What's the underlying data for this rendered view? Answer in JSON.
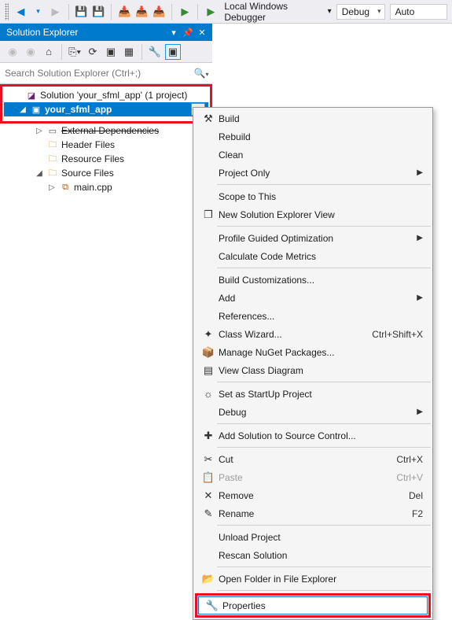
{
  "toolbar": {
    "debugger_label": "Local Windows Debugger",
    "config_value": "Debug",
    "platform_value": "Auto"
  },
  "panel": {
    "title": "Solution Explorer",
    "search_placeholder": "Search Solution Explorer (Ctrl+;)"
  },
  "tree": {
    "solution_label": "Solution 'your_sfml_app' (1 project)",
    "project_label": "your_sfml_app",
    "ext_deps": "External Dependencies",
    "header_files": "Header Files",
    "resource_files": "Resource Files",
    "source_files": "Source Files",
    "main_cpp": "main.cpp"
  },
  "ctx": [
    {
      "type": "item",
      "icon": "hammer",
      "label": "Build"
    },
    {
      "type": "item",
      "label": "Rebuild"
    },
    {
      "type": "item",
      "label": "Clean"
    },
    {
      "type": "item",
      "label": "Project Only",
      "submenu": true
    },
    {
      "type": "sep"
    },
    {
      "type": "item",
      "label": "Scope to This"
    },
    {
      "type": "item",
      "icon": "new-view",
      "label": "New Solution Explorer View"
    },
    {
      "type": "sep"
    },
    {
      "type": "item",
      "label": "Profile Guided Optimization",
      "submenu": true
    },
    {
      "type": "item",
      "label": "Calculate Code Metrics"
    },
    {
      "type": "sep"
    },
    {
      "type": "item",
      "label": "Build Customizations..."
    },
    {
      "type": "item",
      "label": "Add",
      "submenu": true
    },
    {
      "type": "item",
      "label": "References..."
    },
    {
      "type": "item",
      "icon": "wizard",
      "label": "Class Wizard...",
      "shortcut": "Ctrl+Shift+X"
    },
    {
      "type": "item",
      "icon": "nuget",
      "label": "Manage NuGet Packages..."
    },
    {
      "type": "item",
      "icon": "class-diagram",
      "label": "View Class Diagram"
    },
    {
      "type": "sep"
    },
    {
      "type": "item",
      "icon": "startup",
      "label": "Set as StartUp Project"
    },
    {
      "type": "item",
      "label": "Debug",
      "submenu": true
    },
    {
      "type": "sep"
    },
    {
      "type": "item",
      "icon": "source-control",
      "label": "Add Solution to Source Control..."
    },
    {
      "type": "sep"
    },
    {
      "type": "item",
      "icon": "cut",
      "label": "Cut",
      "shortcut": "Ctrl+X"
    },
    {
      "type": "item",
      "icon": "paste",
      "label": "Paste",
      "shortcut": "Ctrl+V",
      "disabled": true
    },
    {
      "type": "item",
      "icon": "remove",
      "label": "Remove",
      "shortcut": "Del"
    },
    {
      "type": "item",
      "icon": "rename",
      "label": "Rename",
      "shortcut": "F2"
    },
    {
      "type": "sep"
    },
    {
      "type": "item",
      "label": "Unload Project"
    },
    {
      "type": "item",
      "label": "Rescan Solution"
    },
    {
      "type": "sep"
    },
    {
      "type": "item",
      "icon": "open-folder",
      "label": "Open Folder in File Explorer"
    },
    {
      "type": "sep"
    },
    {
      "type": "highlight",
      "icon": "properties",
      "label": "Properties"
    }
  ],
  "icon_glyphs": {
    "hammer": "⚒",
    "new-view": "❐",
    "wizard": "✦",
    "nuget": "📦",
    "class-diagram": "▤",
    "startup": "☼",
    "source-control": "✚",
    "cut": "✂",
    "paste": "📋",
    "remove": "✕",
    "rename": "✎",
    "open-folder": "📂",
    "properties": "🔧"
  }
}
